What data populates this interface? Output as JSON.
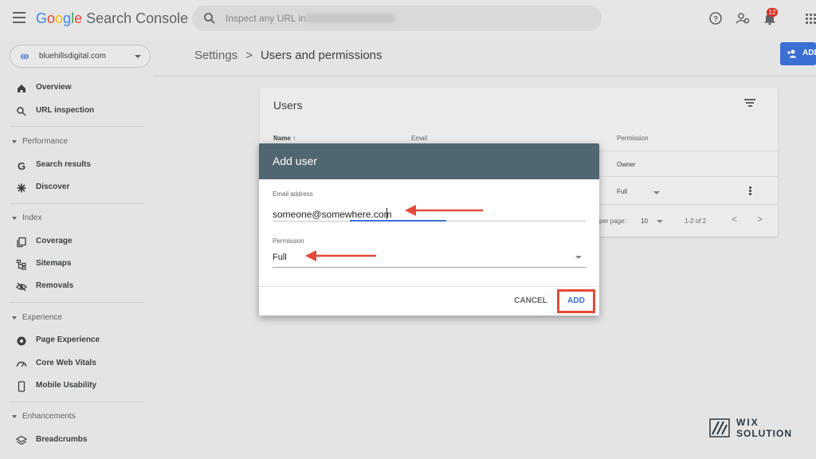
{
  "app": {
    "name_parts": [
      "G",
      "o",
      "o",
      "g",
      "l",
      "e"
    ],
    "name_rest": " Search Console"
  },
  "search": {
    "placeholder": "Inspect any URL in"
  },
  "notifications": {
    "count": "12"
  },
  "property": {
    "label": "bluehillsdigital.com"
  },
  "sidebar": {
    "overview": "Overview",
    "url_inspection": "URL inspection",
    "performance": {
      "header": "Performance",
      "items": [
        "Search results",
        "Discover"
      ]
    },
    "index": {
      "header": "Index",
      "items": [
        "Coverage",
        "Sitemaps",
        "Removals"
      ]
    },
    "experience": {
      "header": "Experience",
      "items": [
        "Page Experience",
        "Core Web Vitals",
        "Mobile Usability"
      ]
    },
    "enhancements": {
      "header": "Enhancements",
      "items": [
        "Breadcrumbs"
      ]
    }
  },
  "breadcrumb": {
    "parent": "Settings",
    "separator": ">",
    "current": "Users and permissions"
  },
  "add_user_top": {
    "label": "ADD"
  },
  "users_table": {
    "title": "Users",
    "columns": {
      "name": "Name",
      "sort_indicator": "↑",
      "email": "Email",
      "permission": "Permission"
    },
    "rows": [
      {
        "permission": "Owner"
      },
      {
        "permission": "Full"
      }
    ],
    "pagination": {
      "rows_per_page_label": "per page:",
      "rows_per_page_value": "10",
      "range": "1-2 of 2",
      "prev": "<",
      "next": ">"
    }
  },
  "dialog": {
    "title": "Add user",
    "email_label": "Email address",
    "email_value": "someone@somewhere.com",
    "permission_label": "Permission",
    "permission_value": "Full",
    "cancel_label": "CANCEL",
    "add_label": "ADD"
  },
  "watermark": {
    "line1": "WIX",
    "line2": "SOLUTION"
  },
  "colors": {
    "accent": "#3b6fd4",
    "dialog_header": "#506671",
    "annotation_red": "#e5483a",
    "badge": "#d93025"
  }
}
